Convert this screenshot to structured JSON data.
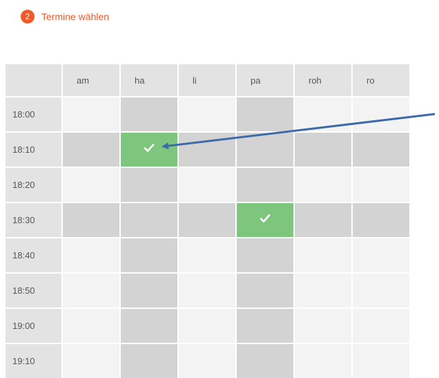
{
  "step": {
    "number": "2",
    "label": "Termine wählen"
  },
  "columns": [
    "am",
    "ha",
    "li",
    "pa",
    "roh",
    "ro"
  ],
  "rows": [
    {
      "time": "18:00",
      "cells": [
        "free",
        "busy",
        "free",
        "busy",
        "free",
        "free"
      ]
    },
    {
      "time": "18:10",
      "cells": [
        "busy",
        "selected",
        "busy",
        "busy",
        "busy",
        "busy"
      ]
    },
    {
      "time": "18:20",
      "cells": [
        "free",
        "busy",
        "free",
        "busy",
        "free",
        "free"
      ]
    },
    {
      "time": "18:30",
      "cells": [
        "busy",
        "busy",
        "busy",
        "selected",
        "busy",
        "busy"
      ]
    },
    {
      "time": "18:40",
      "cells": [
        "free",
        "busy",
        "free",
        "busy",
        "free",
        "free"
      ]
    },
    {
      "time": "18:50",
      "cells": [
        "free",
        "busy",
        "free",
        "busy",
        "free",
        "free"
      ]
    },
    {
      "time": "19:00",
      "cells": [
        "free",
        "busy",
        "free",
        "busy",
        "free",
        "free"
      ]
    },
    {
      "time": "19:10",
      "cells": [
        "free",
        "busy",
        "free",
        "busy",
        "free",
        "free"
      ]
    }
  ],
  "colors": {
    "accent": "#f05a28",
    "selected": "#7ec67e",
    "busy": "#d3d3d3",
    "free": "#f3f3f3",
    "header": "#e3e3e3",
    "arrow": "#3d6aa8"
  },
  "icons": {
    "selected": "check-icon"
  }
}
